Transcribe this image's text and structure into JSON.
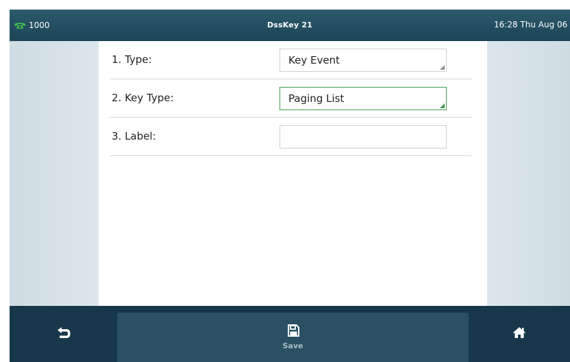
{
  "status_bar": {
    "account": "1000",
    "title": "DssKey 21",
    "datetime": "16:28 Thu Aug 06",
    "icons": {
      "account": "phone-handset-icon"
    },
    "colors": {
      "account_icon": "#3fc14d"
    }
  },
  "form": {
    "rows": [
      {
        "label": "1. Type:",
        "value": "Key Event"
      },
      {
        "label": "2. Key Type:",
        "value": "Paging List"
      },
      {
        "label": "3. Label:",
        "value": ""
      }
    ],
    "focused_row": 1
  },
  "softkeys": {
    "back": {
      "icon": "back-arrow-icon"
    },
    "save": {
      "label": "Save",
      "icon": "save-icon"
    },
    "home": {
      "icon": "home-icon"
    }
  }
}
